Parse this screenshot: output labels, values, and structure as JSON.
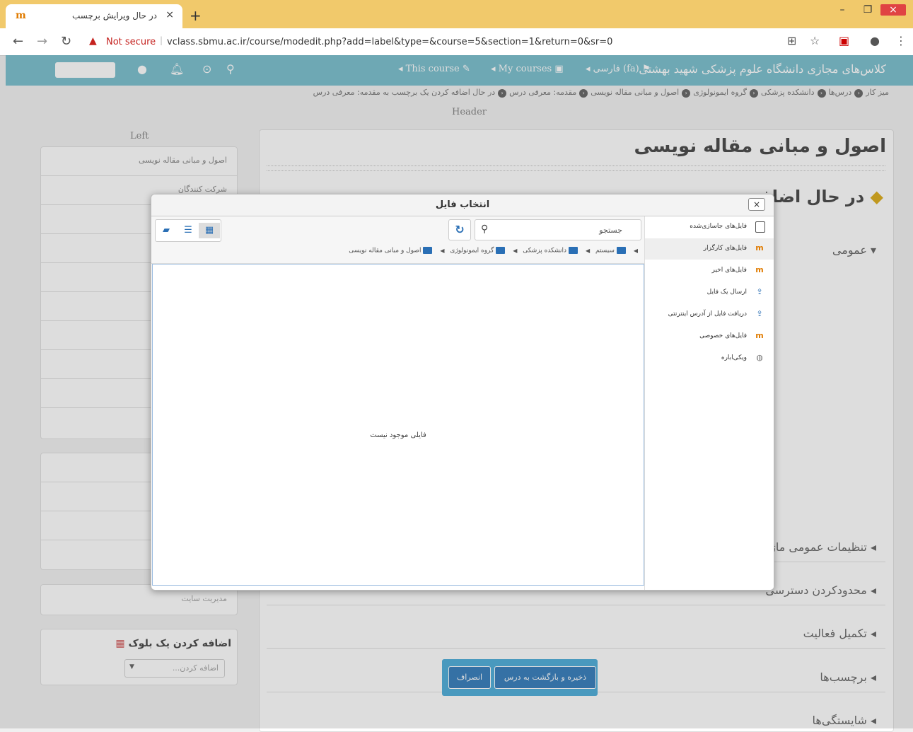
{
  "browser": {
    "tab_title": "در حال ویرایش برچسب",
    "tab_close": "×",
    "new_tab": "+",
    "not_secure": "Not secure",
    "url": "vclass.sbmu.ac.ir/course/modedit.php?add=label&type=&course=5&section=1&return=0&sr=0",
    "win_min": "–",
    "win_max": "❐",
    "win_close": "×"
  },
  "header": {
    "site_name": "کلاس‌های مجازی دانشگاه علوم پزشکی شهید بهشتی",
    "language": "فارسی (fa)",
    "my_courses": "My courses",
    "this_course": "This course"
  },
  "breadcrumb": {
    "items": [
      "میز کار",
      "درس‌ها",
      "دانشکده پزشکی",
      "گروه ایمونولوژی",
      "اصول و مبانی مقاله نویسی",
      "مقدمه: معرفی درس",
      "در حال اضافه کردن یک برچسب به مقدمه: معرفی درس"
    ]
  },
  "region_labels": {
    "header": "Header",
    "left": "Left"
  },
  "left_block": {
    "items": [
      "اصول و مبانی مقاله نویسی",
      "شرکت کنندگان"
    ],
    "partial_item": "رس",
    "admin": "مدیریت سایت"
  },
  "add_block": {
    "title": "اضافه کردن یک بلوک",
    "placeholder": "اضافه کردن..."
  },
  "main": {
    "course_title": "اصول و مبانی مقاله نویسی",
    "adding_title": "در حال اضافه",
    "general": "عمومی",
    "sections": [
      "تنظیمات عمومی ماژو",
      "محدودکردن دسترسی",
      "تکمیل فعالیت",
      "برچسب‌ها",
      "شایستگی‌ها"
    ],
    "save_return": "ذخیره و بازگشت به درس",
    "cancel": "انصراف"
  },
  "dialog": {
    "title": "انتخاب فایل",
    "close": "×",
    "search_placeholder": "جستجو",
    "repositories": [
      "فایل‌های جاسازی‌شده",
      "فایل‌های کارگزار",
      "فایل‌های اخیر",
      "ارسال یک فایل",
      "دریافت فایل از آدرس اینترنتی",
      "فایل‌های خصوصی",
      "ویکی‌اباره"
    ],
    "active_repository": "فایل‌های کارگزار",
    "path": [
      "سیستم",
      "دانشکده پزشکی",
      "گروه ایمونولوژی",
      "اصول و مبانی مقاله نویسی"
    ],
    "empty_message": "فایلی موجود نیست"
  }
}
